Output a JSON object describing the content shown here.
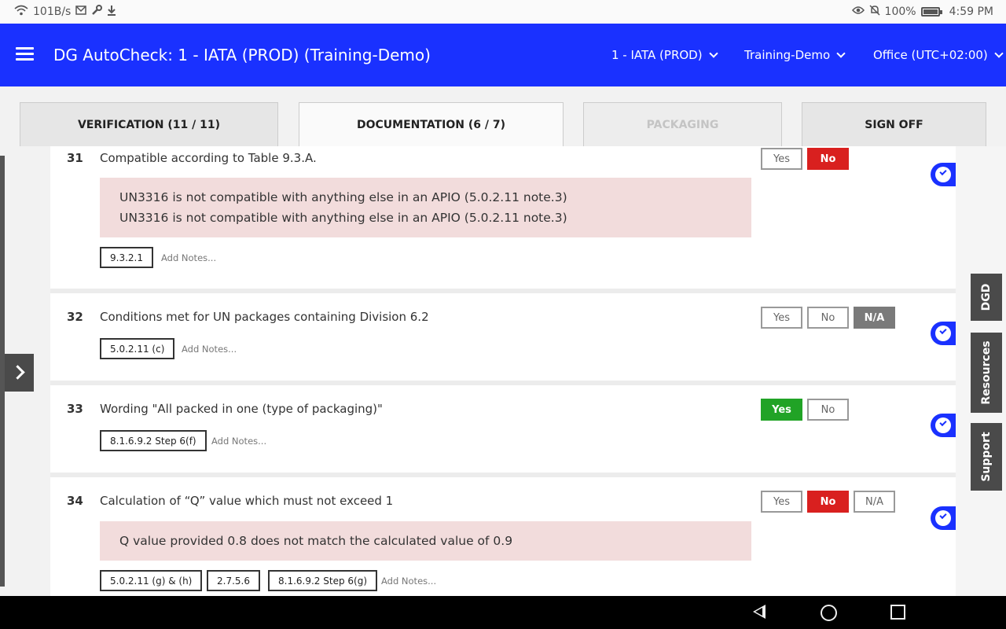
{
  "status_bar": {
    "net_speed": "101B/s",
    "battery": "100%",
    "time": "4:59 PM"
  },
  "header": {
    "title": "DG AutoCheck: 1 - IATA (PROD) (Training-Demo)",
    "dropdowns": [
      "1 - IATA (PROD)",
      "Training-Demo",
      "Office (UTC+02:00)"
    ]
  },
  "tabs": [
    {
      "label": "VERIFICATION (11 / 11)"
    },
    {
      "label": "DOCUMENTATION (6 / 7)"
    },
    {
      "label": "PACKAGING"
    },
    {
      "label": "SIGN OFF"
    }
  ],
  "colors": {
    "brand": "#1a31ff",
    "no_selected": "#d9201f",
    "yes_selected": "#21a326",
    "na_selected": "#7a7a7a",
    "message_bg": "#f2dcdc"
  },
  "questions": [
    {
      "number": "31",
      "text": "Compatible according to Table 9.3.A.",
      "messages": [
        "UN3316 is not compatible with anything else in an APIO (5.0.2.11 note.3)",
        "UN3316 is not compatible with anything else in an APIO (5.0.2.11 note.3)"
      ],
      "refs": [
        "9.3.2.1"
      ],
      "add_notes": "Add Notes...",
      "answers": [
        "Yes",
        "No"
      ],
      "selected": "No"
    },
    {
      "number": "32",
      "text": "Conditions met for UN packages containing Division 6.2",
      "refs": [
        "5.0.2.11 (c)"
      ],
      "add_notes": "Add Notes...",
      "answers": [
        "Yes",
        "No",
        "N/A"
      ],
      "selected": "N/A"
    },
    {
      "number": "33",
      "text": "Wording \"All packed in one (type of packaging)\"",
      "refs": [
        "8.1.6.9.2 Step 6(f)"
      ],
      "add_notes": "Add Notes...",
      "answers": [
        "Yes",
        "No"
      ],
      "selected": "Yes"
    },
    {
      "number": "34",
      "text": "Calculation of “Q” value which must not exceed 1",
      "messages": [
        "Q value provided 0.8 does not match the calculated value of 0.9"
      ],
      "refs": [
        "5.0.2.11 (g) & (h)",
        "2.7.5.6",
        "8.1.6.9.2 Step 6(g)"
      ],
      "add_notes": "Add Notes...",
      "answers": [
        "Yes",
        "No",
        "N/A"
      ],
      "selected": "No"
    }
  ],
  "side_tabs": [
    "DGD",
    "Resources",
    "Support"
  ]
}
